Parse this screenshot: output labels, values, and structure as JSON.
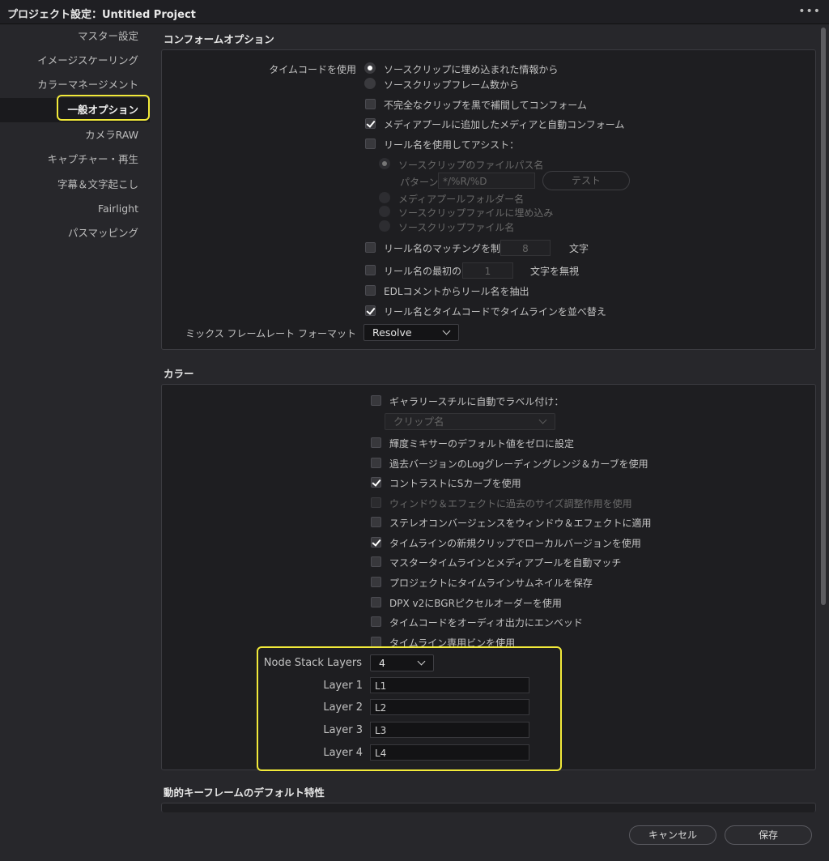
{
  "window": {
    "title": "プロジェクト設定：Untitled Project",
    "more": "•••"
  },
  "sidebar": {
    "items": [
      {
        "label": "マスター設定"
      },
      {
        "label": "イメージスケーリング"
      },
      {
        "label": "カラーマネージメント"
      },
      {
        "label": "一般オプション"
      },
      {
        "label": "カメラRAW"
      },
      {
        "label": "キャプチャー・再生"
      },
      {
        "label": "字幕＆文字起こし"
      },
      {
        "label": "Fairlight"
      },
      {
        "label": "パスマッピング"
      }
    ]
  },
  "conform": {
    "title": "コンフォームオプション",
    "timecode_label": "タイムコードを使用",
    "tc_opt1": "ソースクリップに埋め込まれた情報から",
    "tc_opt2": "ソースクリップフレーム数から",
    "fill_incomplete": "不完全なクリップを黒で補間してコンフォーム",
    "auto_conform": "メディアプールに追加したメディアと自動コンフォーム",
    "reel_assist": "リール名を使用してアシスト：",
    "reel_src_path": "ソースクリップのファイルパス名",
    "pattern_label": "パターン",
    "pattern_value": "*/%R/%D",
    "test_button": "テスト",
    "reel_folder": "メディアプールフォルダー名",
    "reel_embedded": "ソースクリップファイルに埋め込み",
    "reel_filename": "ソースクリップファイル名",
    "limit_reel": "リール名のマッチングを制限",
    "limit_value": "8",
    "chars": "文字",
    "ignore_first": "リール名の最初の",
    "ignore_value": "1",
    "ignore_chars": "文字を無視",
    "edl_extract": "EDLコメントからリール名を抽出",
    "sort_timeline": "リール名とタイムコードでタイムラインを並べ替え",
    "mixed_fps_label": "ミックス フレームレート フォーマット",
    "mixed_fps_value": "Resolve"
  },
  "color": {
    "title": "カラー",
    "gallery_label": "ギャラリースチルに自動でラベル付け：",
    "gallery_dropdown": "クリップ名",
    "luma_mixer": "輝度ミキサーのデフォルト値をゼロに設定",
    "legacy_log": "過去バージョンのLogグレーディングレンジ＆カーブを使用",
    "s_curve": "コントラストにSカーブを使用",
    "legacy_sizing": "ウィンドウ＆エフェクトに過去のサイズ調整作用を使用",
    "stereo": "ステレオコンバージェンスをウィンドウ＆エフェクトに適用",
    "local_version": "タイムラインの新規クリップでローカルバージョンを使用",
    "auto_match": "マスタータイムラインとメディアプールを自動マッチ",
    "save_thumbs": "プロジェクトにタイムラインサムネイルを保存",
    "dpx_bgr": "DPX v2にBGRピクセルオーダーを使用",
    "embed_tc": "タイムコードをオーディオ出力にエンベッド",
    "timeline_bin": "タイムライン専用ビンを使用",
    "node_stack_label": "Node Stack Layers",
    "node_stack_value": "4",
    "layers": [
      {
        "label": "Layer 1",
        "value": "L1"
      },
      {
        "label": "Layer 2",
        "value": "L2"
      },
      {
        "label": "Layer 3",
        "value": "L3"
      },
      {
        "label": "Layer 4",
        "value": "L4"
      }
    ]
  },
  "keyframes": {
    "title": "動的キーフレームのデフォルト特性"
  },
  "footer": {
    "cancel": "キャンセル",
    "save": "保存"
  },
  "colors": {
    "highlight": "#f2ea3a",
    "background": "#27272b",
    "panel": "#1e1e21"
  }
}
